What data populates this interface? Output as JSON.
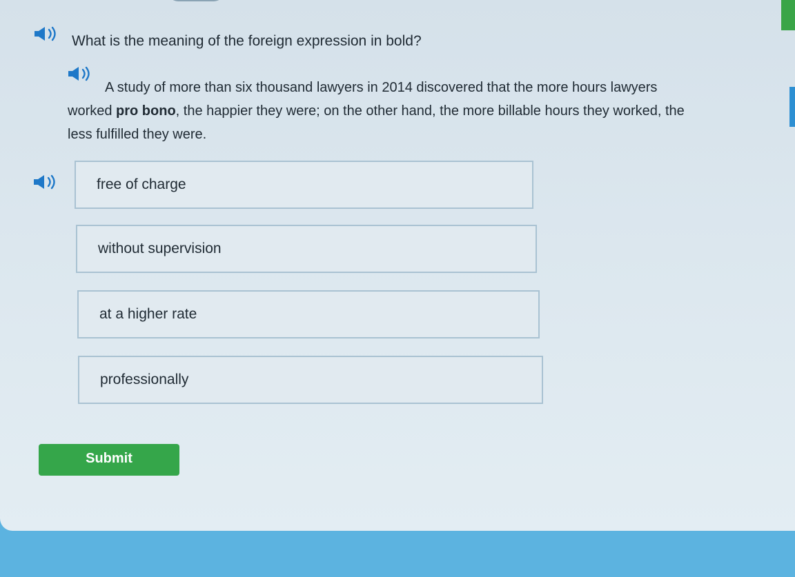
{
  "question": {
    "prompt": "What is the meaning of the foreign expression in bold?"
  },
  "passage": {
    "line1": "A study of more than six thousand lawyers in 2014 discovered that the more hours lawyers",
    "line2_before": "worked ",
    "bold_expression": "pro bono",
    "line2_after": ", the happier they were; on the other hand, the more billable hours they worked, the",
    "line3": "less fulfilled they were."
  },
  "options": [
    {
      "label": "free of charge"
    },
    {
      "label": "without supervision"
    },
    {
      "label": "at a higher rate"
    },
    {
      "label": "professionally"
    }
  ],
  "submit": {
    "label": "Submit"
  },
  "icons": {
    "speaker": "speaker-icon"
  },
  "colors": {
    "accent_green": "#35a64a",
    "background_blue": "#5cb3e0",
    "option_border": "#a9c2d2",
    "speaker_blue": "#1e78c8"
  }
}
